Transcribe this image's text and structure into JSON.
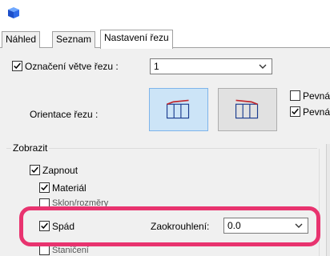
{
  "tabs": [
    {
      "label": "Náhled"
    },
    {
      "label": "Seznam"
    },
    {
      "label": "Nastavení řezu"
    }
  ],
  "branch": {
    "label": "Označení větve řezu :",
    "value": "1",
    "checked": true
  },
  "orientation": {
    "label": "Orientace řezu :"
  },
  "right_options": [
    {
      "label": "Pevná",
      "checked": false
    },
    {
      "label": "Pevná",
      "checked": true
    }
  ],
  "display": {
    "group_label": "Zobrazit",
    "enable": {
      "label": "Zapnout",
      "checked": true
    },
    "material": {
      "label": "Materiál",
      "checked": true
    },
    "hidden_row": {
      "label": "Sklon/rozměry"
    },
    "slope": {
      "label": "Spád",
      "checked": true
    },
    "rounding": {
      "label": "Zaokrouhlení:",
      "value": "0.0"
    },
    "bottom_row": {
      "label": "Staničení"
    }
  },
  "colors": {
    "highlight": "#e8336f",
    "selected_button": "#cce4f7",
    "icon_red": "#c0272d",
    "icon_blue": "#1a3c8f"
  }
}
